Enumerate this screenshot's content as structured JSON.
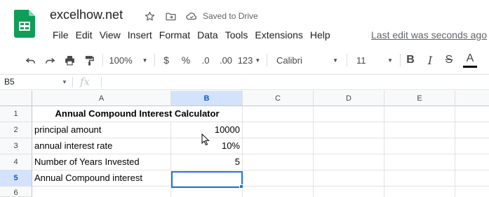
{
  "app": {
    "doc_title": "excelhow.net",
    "saved_status": "Saved to Drive",
    "last_edit": "Last edit was seconds ago",
    "brand_color": "#0f9d58"
  },
  "menu": [
    "File",
    "Edit",
    "View",
    "Insert",
    "Format",
    "Data",
    "Tools",
    "Extensions",
    "Help"
  ],
  "toolbar": {
    "zoom": "100%",
    "currency": "$",
    "percent": "%",
    "decrease_decimals": ".0",
    "increase_decimals": ".00",
    "more_formats": "123",
    "font": "Calibri",
    "font_size": "11",
    "bold": "B",
    "italic": "I",
    "strikethrough": "S",
    "text_color": "A"
  },
  "formula_bar": {
    "name_box": "B5",
    "fx_label": "fx",
    "formula": ""
  },
  "columns": [
    "A",
    "B",
    "C",
    "D",
    "E"
  ],
  "rows": [
    "1",
    "2",
    "3",
    "4",
    "5",
    "6"
  ],
  "cells": {
    "A1": "Annual Compound Interest Calculator",
    "A2": "principal amount",
    "B2": "10000",
    "A3": "annual interest rate",
    "B3": "10%",
    "A4": "Number of Years Invested",
    "B4": "5",
    "A5": "Annual Compound interest",
    "B5": ""
  }
}
